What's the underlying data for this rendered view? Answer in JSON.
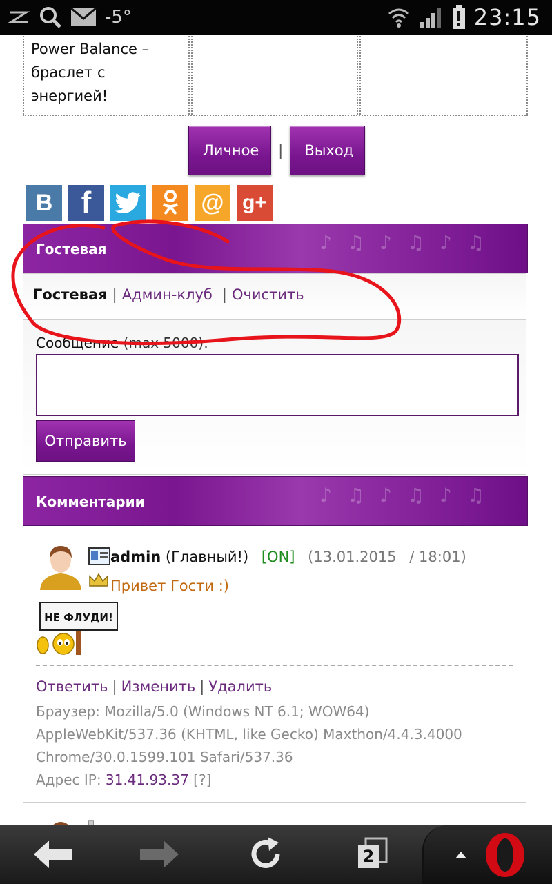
{
  "status_bar": {
    "temperature": "-5°",
    "time": "23:15"
  },
  "top_grid": {
    "promo_text": "Power Balance – браслет с энергией!"
  },
  "user_buttons": {
    "personal_label": "Личное",
    "separator": "|",
    "logout_label": "Выход"
  },
  "social": [
    "vk-icon",
    "facebook-icon",
    "twitter-icon",
    "odnoklassniki-icon",
    "mailru-icon",
    "googleplus-icon"
  ],
  "guestbook": {
    "header": "Гостевая",
    "tabs": [
      {
        "label": "Гостевая",
        "active": true
      },
      {
        "label": "Админ-клуб",
        "active": false
      },
      {
        "label": "Очистить",
        "active": false
      }
    ],
    "message_label": "Сообщение",
    "message_limit": "(max 5000):",
    "message_value": "",
    "send_label": "Отправить"
  },
  "comments": {
    "header": "Комментарии",
    "items": [
      {
        "author": "admin",
        "role": "(Главный!)",
        "status": "[ON]",
        "date": "(13.01.2015",
        "time": "/ 18:01)",
        "text": "Привет Гости :)",
        "sticker_text": "НЕ ФЛУДИ!",
        "actions": [
          "Ответить",
          "Изменить",
          "Удалить"
        ],
        "browser_prefix": "Браузер:",
        "browser_line1": "Mozilla/5.0 (Windows NT 6.1; WOW64)",
        "browser_line2": "AppleWebKit/537.36 (KHTML, like Gecko) Maxthon/4.4.3.4000",
        "browser_line3": "Chrome/30.0.1599.101 Safari/537.36",
        "ip_prefix": "Адрес IP:",
        "ip": "31.41.93.37",
        "ip_help": "[?]"
      }
    ]
  },
  "toolbar": {
    "tab_count": "2"
  },
  "colors": {
    "accent_purple": "#7a1690",
    "link_purple": "#6b2b7d",
    "online_green": "#1e8c1e",
    "message_orange": "#c26a12",
    "annotation_red": "#e8141b"
  }
}
